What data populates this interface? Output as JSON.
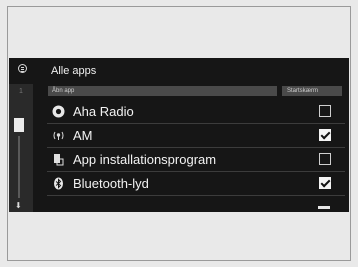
{
  "screen": {
    "title": "Alle apps",
    "columns": {
      "app": "Åbn app",
      "start": "Startskærm"
    },
    "scroll_page": "1",
    "apps": [
      {
        "label": "Aha Radio",
        "icon": "aha-radio-icon",
        "checked": false
      },
      {
        "label": "AM",
        "icon": "am-radio-icon",
        "checked": true
      },
      {
        "label": "App installationsprogram",
        "icon": "app-installer-icon",
        "checked": false
      },
      {
        "label": "Bluetooth-lyd",
        "icon": "bluetooth-icon",
        "checked": true
      }
    ]
  }
}
